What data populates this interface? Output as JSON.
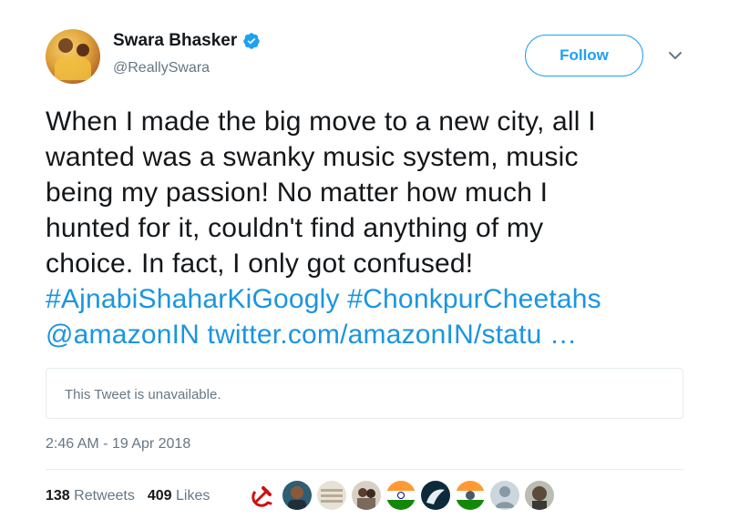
{
  "user": {
    "name": "Swara Bhasker",
    "handle": "@ReallySwara",
    "verified_icon": "verified-badge-icon",
    "verified_color": "#1da1f2"
  },
  "actions": {
    "follow_label": "Follow",
    "more_icon": "chevron-down-icon"
  },
  "tweet": {
    "lines": [
      "When I made the big move to a new city, all I",
      "wanted was a swanky music system, music",
      "being my passion! No matter how much I",
      "hunted for it, couldn't find anything of my",
      "choice. In fact, I only got confused!"
    ],
    "hashtag1": "#AjnabiShaharKiGoogly",
    "hashtag2": "#ChonkpurCheetahs",
    "mention": "@amazonIN",
    "link": "twitter.com/amazonIN/statu …"
  },
  "quoted": {
    "text": "This Tweet is unavailable."
  },
  "meta": {
    "timestamp": "2:46 AM - 19 Apr 2018"
  },
  "stats": {
    "retweets_count": "138",
    "retweets_label": "Retweets",
    "likes_count": "409",
    "likes_label": "Likes"
  },
  "colors": {
    "link": "#1b95e0",
    "muted": "#657786",
    "text": "#14171a",
    "border": "#e6ecf0"
  }
}
